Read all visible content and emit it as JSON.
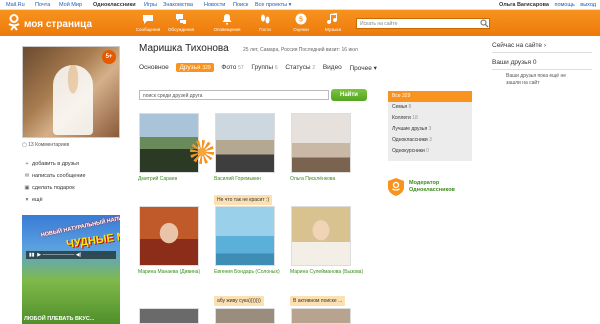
{
  "portal": {
    "links": [
      "Mail.Ru",
      "Почта",
      "Мой Мир",
      "Одноклассники",
      "Игры",
      "Знакомства",
      "Новости",
      "Поиск",
      "Все проекты ▾"
    ],
    "user": "Ольга Вагисарова",
    "help": "помощь",
    "exit": "выход"
  },
  "header": {
    "logo": "моя страница",
    "nav": [
      "Сообщения",
      "Обсуждения",
      "Оповещения",
      "Гости",
      "Оценки",
      "Музыка"
    ],
    "search_placeholder": "Искать на сайте"
  },
  "colors": {
    "accent": "#f7931e",
    "link": "#1e5bb8",
    "green": "#3a8c1a"
  },
  "profile": {
    "name": "Маришка Тихонова",
    "meta": "25 лет, Самара, Россия Последний визит: 16 июл",
    "badge": "5+",
    "comments": "13 Комментариев",
    "actions": [
      "добавить в друзья",
      "написать сообщение",
      "сделать подарок",
      "ещё"
    ],
    "tabs": [
      {
        "label": "Основное",
        "count": ""
      },
      {
        "label": "Друзья",
        "count": "329"
      },
      {
        "label": "Фото",
        "count": "57"
      },
      {
        "label": "Группы",
        "count": "6"
      },
      {
        "label": "Статусы",
        "count": "2"
      },
      {
        "label": "Видео",
        "count": ""
      },
      {
        "label": "Прочее ▾",
        "count": ""
      }
    ]
  },
  "friends_search": {
    "placeholder": "поиск среди друзей друга",
    "button": "Найти"
  },
  "friends": [
    {
      "name": "Дмитрий Сараев",
      "status": ""
    },
    {
      "name": "Василий Горемыкин",
      "status": ""
    },
    {
      "name": "Ольга Писклёнкова",
      "status": ""
    },
    {
      "name": "Марина Манаева (Дивина)",
      "status": ""
    },
    {
      "name": "Евгения Бондарь (Солоных)",
      "status": "Не что так не красит :)"
    },
    {
      "name": "Марина Сулейманова (Бызова)",
      "status": ""
    },
    {
      "name": "",
      "status": ""
    },
    {
      "name": "",
      "status": "абу живу сука)))))))"
    },
    {
      "name": "",
      "status": "В активном поиске ..."
    }
  ],
  "filter": [
    {
      "label": "Все",
      "count": "329"
    },
    {
      "label": "Семья",
      "count": "8"
    },
    {
      "label": "Коллеги",
      "count": "18"
    },
    {
      "label": "Лучшие друзья",
      "count": "3"
    },
    {
      "label": "Одноклассники",
      "count": "3"
    },
    {
      "label": "Однокурсники",
      "count": "0"
    }
  ],
  "moderator": {
    "line1": "Модератор",
    "line2": "Одноклассников"
  },
  "right": {
    "events_title": "Сейчас на сайте ›",
    "friends_title": "Ваши друзья 0",
    "friends_text": "Ваши друзья пока ещё не зашли на сайт"
  },
  "ad": {
    "line1": "НОВЫЙ НАТУРАЛЬНЫЙ НАПИТОК",
    "line2": "ЧУДНЫЕ МИКС",
    "bottom": "ЛЮБОЙ ПЛЕВАТЬ ВКУС..."
  }
}
